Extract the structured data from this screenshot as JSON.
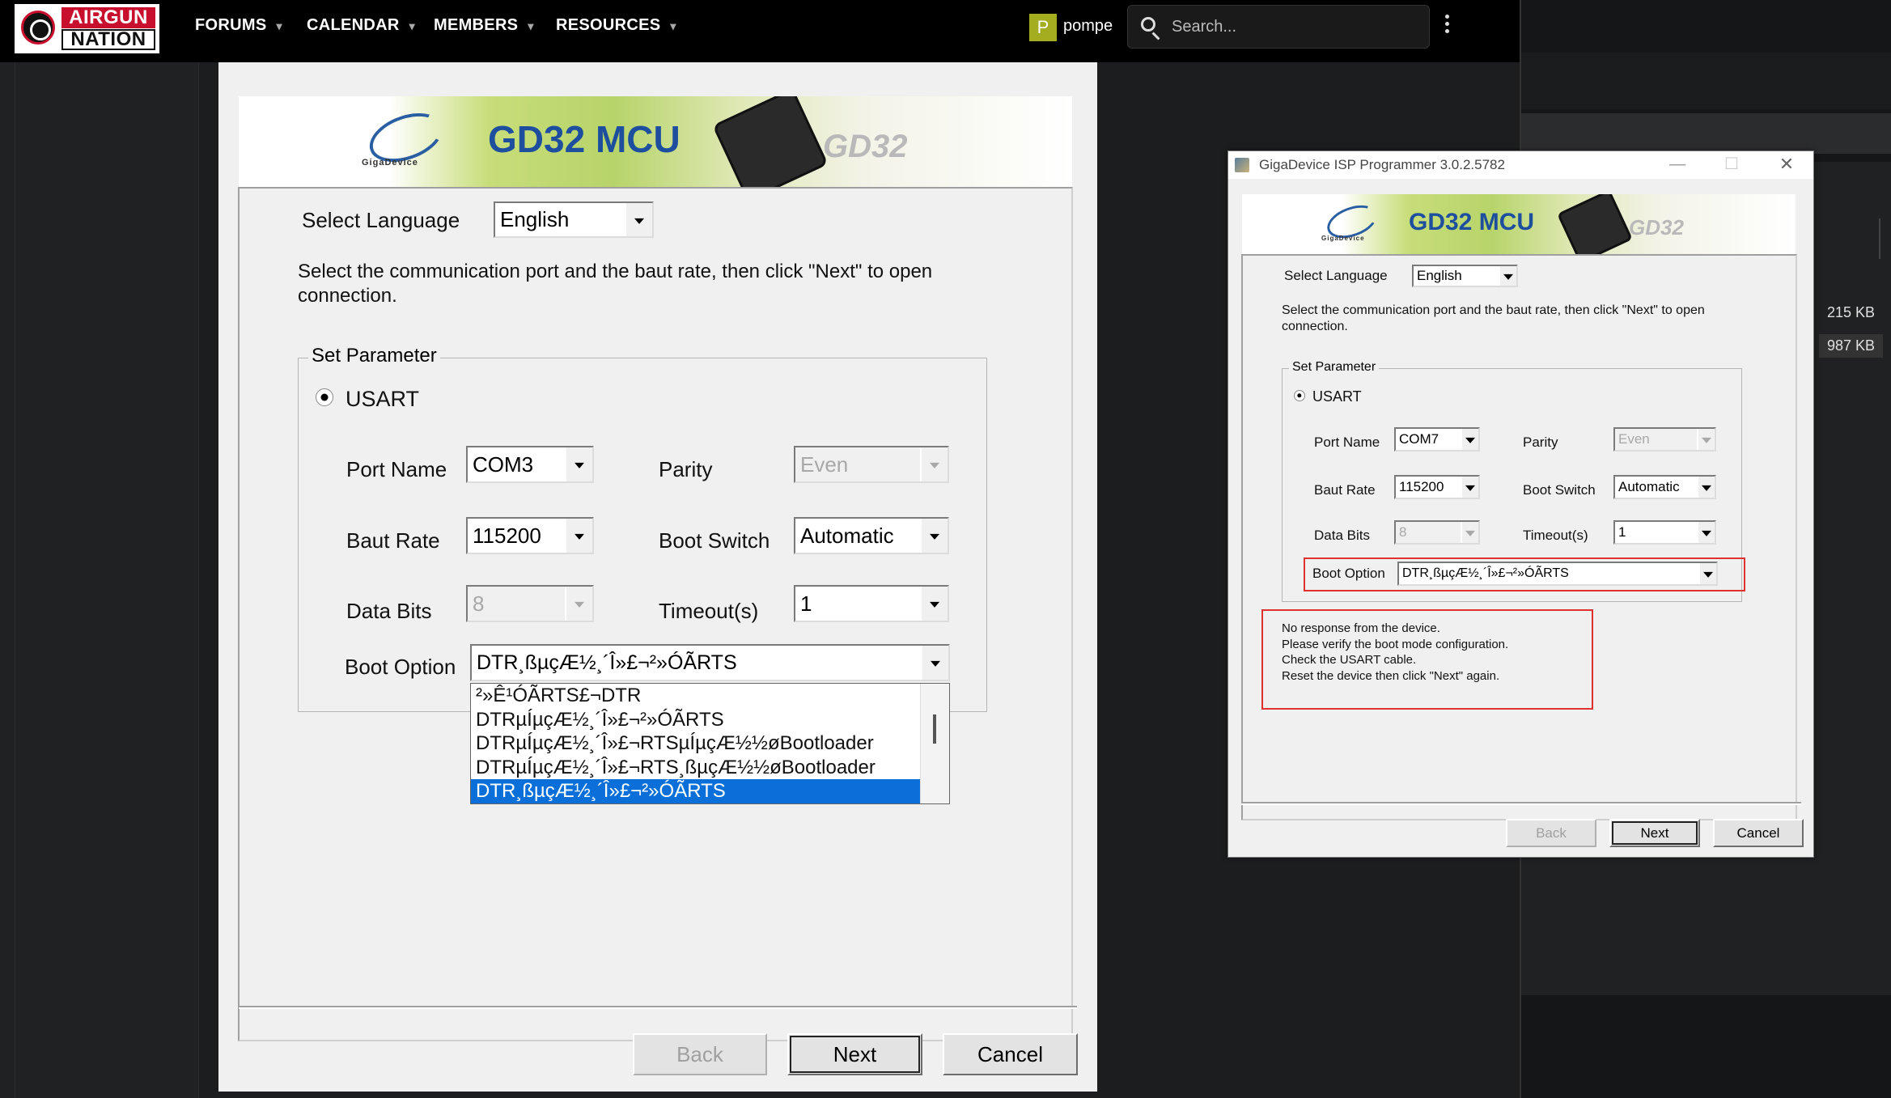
{
  "navbar": {
    "logo_line1": "AIRGUN",
    "logo_line2": "NATION",
    "items": [
      {
        "label": "FORUMS"
      },
      {
        "label": "CALENDAR"
      },
      {
        "label": "MEMBERS"
      },
      {
        "label": "RESOURCES"
      }
    ],
    "avatar_letter": "P",
    "username": "pompe",
    "search_placeholder": "Search..."
  },
  "attachments": {
    "sizes": [
      "215 KB",
      "987 KB"
    ]
  },
  "left_dialog": {
    "banner_title": "GD32 MCU",
    "brand": "GigaDevice",
    "banner_ghost": "GD32",
    "select_language_label": "Select Language",
    "language": "English",
    "instructions": "Select the communication port and the baut rate, then click \"Next\" to open connection.",
    "group_title": "Set Parameter",
    "usart_label": "USART",
    "port_name_label": "Port Name",
    "port_name": "COM3",
    "parity_label": "Parity",
    "parity": "Even",
    "baud_rate_label": "Baut Rate",
    "baud_rate": "115200",
    "boot_switch_label": "Boot Switch",
    "boot_switch": "Automatic",
    "data_bits_label": "Data Bits",
    "data_bits": "8",
    "timeout_label": "Timeout(s)",
    "timeout": "1",
    "boot_option_label": "Boot Option",
    "boot_option": "DTR¸ßµçÆ½¸´Î»£¬²»ÓÃRTS",
    "boot_option_list": [
      "²»Ê¹ÓÃRTS£¬DTR",
      "DTRµÍµçÆ½¸´Î»£¬²»ÓÃRTS",
      "DTRµÍµçÆ½¸´Î»£¬RTSµÍµçÆ½½øBootloader",
      "DTRµÍµçÆ½¸´Î»£¬RTS¸ßµçÆ½½øBootloader",
      "DTR¸ßµçÆ½¸´Î»£¬²»ÓÃRTS"
    ],
    "back_label": "Back",
    "next_label": "Next",
    "cancel_label": "Cancel"
  },
  "right_dialog": {
    "window_title": "GigaDevice ISP Programmer 3.0.2.5782",
    "banner_title": "GD32 MCU",
    "brand": "GigaDevice",
    "banner_ghost": "GD32",
    "select_language_label": "Select Language",
    "language": "English",
    "instructions": "Select the communication port and the baut rate, then click \"Next\" to open connection.",
    "group_title": "Set Parameter",
    "usart_label": "USART",
    "port_name_label": "Port Name",
    "port_name": "COM7",
    "parity_label": "Parity",
    "parity": "Even",
    "baud_rate_label": "Baut Rate",
    "baud_rate": "115200",
    "boot_switch_label": "Boot Switch",
    "boot_switch": "Automatic",
    "data_bits_label": "Data Bits",
    "data_bits": "8",
    "timeout_label": "Timeout(s)",
    "timeout": "1",
    "boot_option_label": "Boot Option",
    "boot_option": "DTR¸ßµçÆ½¸´Î»£¬²»ÓÃRTS",
    "message_lines": [
      "No response from the device.",
      "Please verify the boot mode configuration.",
      "Check the USART cable.",
      "Reset the device then click \"Next\" again."
    ],
    "back_label": "Back",
    "next_label": "Next",
    "cancel_label": "Cancel"
  },
  "colors": {
    "navbar_bg": "#000000",
    "logo_red": "#c8102e",
    "avatar_bg": "#a3ad1f",
    "selection_blue": "#0a6fd8",
    "highlight_red": "#e03030",
    "banner_title_blue": "#1d4f9e"
  }
}
